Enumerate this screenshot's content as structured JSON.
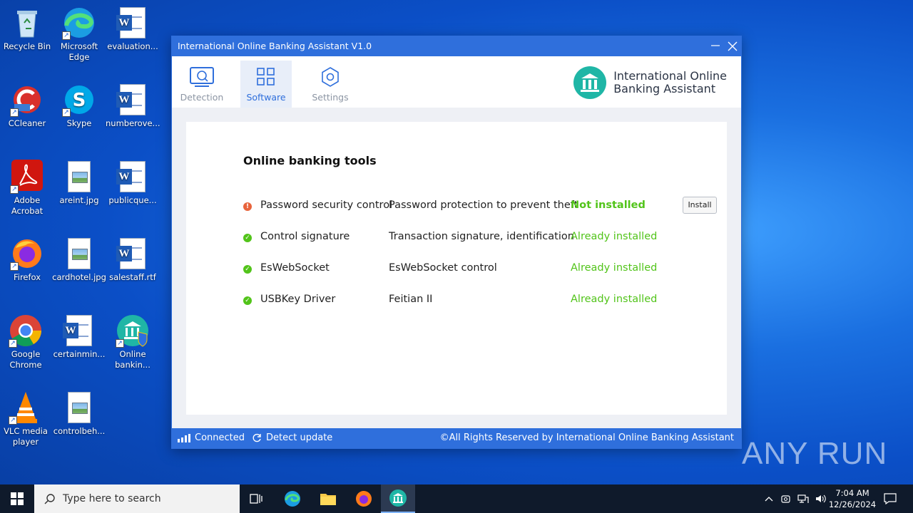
{
  "desktop": {
    "icons": [
      {
        "label": "Recycle Bin"
      },
      {
        "label": "Microsoft Edge"
      },
      {
        "label": "evaluation..."
      },
      {
        "label": "CCleaner"
      },
      {
        "label": "Skype"
      },
      {
        "label": "numberove..."
      },
      {
        "label": "Adobe Acrobat"
      },
      {
        "label": "areint.jpg"
      },
      {
        "label": "publicque..."
      },
      {
        "label": "Firefox"
      },
      {
        "label": "cardhotel.jpg"
      },
      {
        "label": "salestaff.rtf"
      },
      {
        "label": "Google Chrome"
      },
      {
        "label": "certainmin..."
      },
      {
        "label": "Online bankin..."
      },
      {
        "label": "VLC media player"
      },
      {
        "label": "controlbeh..."
      }
    ]
  },
  "window": {
    "title": "International Online Banking Assistant V1.0",
    "tabs": [
      {
        "label": "Detection"
      },
      {
        "label": "Software"
      },
      {
        "label": "Settings"
      }
    ],
    "active_tab": "Software",
    "brand": {
      "line1": "International Online",
      "line2": "Banking Assistant"
    },
    "section_title": "Online banking tools",
    "tools": [
      {
        "name": "Password security control",
        "description": "Password protection to prevent theft",
        "status": "Not installed",
        "action": "Install"
      },
      {
        "name": "Control signature",
        "description": "Transaction signature, identification",
        "status": "Already installed"
      },
      {
        "name": "EsWebSocket",
        "description": "EsWebSocket control",
        "status": "Already installed"
      },
      {
        "name": "USBKey Driver",
        "description": "Feitian II",
        "status": "Already installed"
      }
    ],
    "statusbar": {
      "connection": "Connected",
      "update": "Detect update",
      "copyright": "©All Rights Reserved by International Online Banking Assistant"
    }
  },
  "colors": {
    "accent": "#2f6fdc",
    "installed": "#52c41a",
    "warning": "#e8643c"
  },
  "taskbar": {
    "search_placeholder": "Type here to search",
    "time": "7:04 AM",
    "date": "12/26/2024"
  },
  "watermark": "ANY RUN"
}
